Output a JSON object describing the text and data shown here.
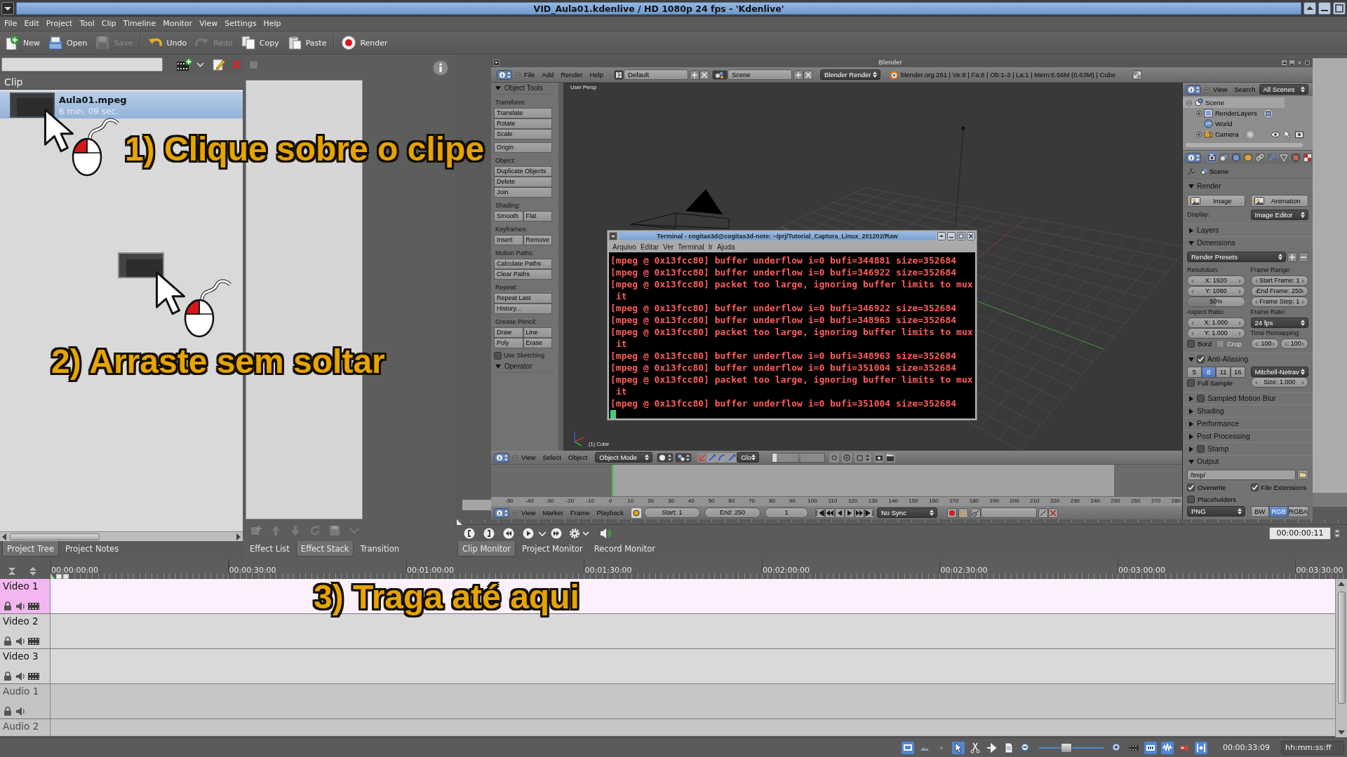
{
  "window": {
    "title": "VID_Aula01.kdenlive / HD 1080p 24 fps - 'Kdenlive'"
  },
  "menu_bar": [
    "File",
    "Edit",
    "Project",
    "Tool",
    "Clip",
    "Timeline",
    "Monitor",
    "View",
    "Settings",
    "Help"
  ],
  "toolbar": {
    "groups": [
      [
        {
          "label": "New",
          "disabled": false
        },
        {
          "label": "Open",
          "disabled": false
        },
        {
          "label": "Save",
          "disabled": true
        }
      ],
      [
        {
          "label": "Undo",
          "disabled": false
        },
        {
          "label": "Redo",
          "disabled": true
        },
        {
          "label": "Copy",
          "disabled": false
        },
        {
          "label": "Paste",
          "disabled": false
        }
      ],
      [
        {
          "label": "Render",
          "disabled": false
        }
      ]
    ]
  },
  "project_tree": {
    "column_header": "Clip",
    "clips": [
      {
        "name": "Aula01.mpeg",
        "duration": "6 min. 09 sec.",
        "selected": true
      }
    ],
    "tabs": [
      {
        "label": "Project Tree",
        "selected": true
      },
      {
        "label": "Project Notes",
        "selected": false
      }
    ]
  },
  "effect_stack": {
    "checkbox": {
      "checked": false
    },
    "tabs": [
      {
        "label": "Effect List",
        "selected": false
      },
      {
        "label": "Effect Stack",
        "selected": true
      },
      {
        "label": "Transition",
        "selected": false
      }
    ]
  },
  "monitor": {
    "blender": {
      "title": "Blender",
      "info_header": {
        "menus": [
          "File",
          "Add",
          "Render",
          "Help"
        ],
        "layout": "Default",
        "scene": "Scene",
        "engine": "Blender Render",
        "stats": "blender.org 261 | Ve:8 | Fa:6 | Ob:1-3 | La:1 | Mem:6.56M (0.63M) | Cube"
      },
      "tool_shelf": {
        "panels": [
          {
            "title": "Object Tools",
            "expanded": true,
            "sections": [
              {
                "label": "Transform:",
                "rows": [
                  [
                    "Translate"
                  ],
                  [
                    "Rotate"
                  ],
                  [
                    "Scale"
                  ]
                ]
              },
              {
                "rows": [
                  [
                    "Origin"
                  ]
                ]
              },
              {
                "label": "Object:",
                "rows": [
                  [
                    "Duplicate Objects"
                  ],
                  [
                    "Delete"
                  ],
                  [
                    "Join"
                  ]
                ]
              },
              {
                "label": "Shading:",
                "rows": [
                  [
                    "Smooth",
                    "Flat"
                  ]
                ]
              },
              {
                "label": "Keyframes:",
                "rows": [
                  [
                    "Insert",
                    "Remove"
                  ]
                ]
              },
              {
                "label": "Motion Paths:",
                "rows": [
                  [
                    "Calculate Paths"
                  ],
                  [
                    "Clear Paths"
                  ]
                ]
              },
              {
                "label": "Repeat:",
                "rows": [
                  [
                    "Repeat Last"
                  ],
                  [
                    "History..."
                  ]
                ]
              },
              {
                "label": "Grease Pencil:",
                "rows": [
                  [
                    "Draw",
                    "Line"
                  ],
                  [
                    "Poly",
                    "Erase"
                  ]
                ]
              }
            ],
            "checkboxes": [
              {
                "label": "Use Sketching",
                "checked": false
              }
            ]
          },
          {
            "title": "Operator",
            "expanded": true
          }
        ]
      },
      "viewport": {
        "view_name": "User Persp",
        "object_name": "(1) Cube"
      },
      "view3d_header": {
        "menus": [
          "View",
          "Select",
          "Object"
        ],
        "mode": "Object Mode",
        "orientation": "Glo"
      },
      "timeline": {
        "ticks": [
          "-50",
          "-40",
          "-30",
          "-20",
          "-10",
          "0",
          "10",
          "20",
          "30",
          "40",
          "50",
          "60",
          "70",
          "80",
          "90",
          "100",
          "110",
          "120",
          "130",
          "140",
          "150",
          "160",
          "170",
          "180",
          "190",
          "200",
          "210",
          "220",
          "230",
          "240",
          "250",
          "260",
          "270",
          "280"
        ],
        "header": {
          "menus": [
            "View",
            "Marker",
            "Frame",
            "Playback"
          ],
          "start": "Start: 1",
          "end": "End: 250",
          "frame": "1",
          "sync": "No Sync"
        }
      },
      "outliner": {
        "menus": [
          "View",
          "Search"
        ],
        "filter": "All Scenes",
        "tree": [
          {
            "label": "Scene",
            "selected": true,
            "expanded": true,
            "children": [
              {
                "label": "RenderLayers",
                "selected": false,
                "expanded": false
              },
              {
                "label": "World",
                "selected": false
              },
              {
                "label": "Camera",
                "selected": false,
                "expanded": false
              }
            ]
          }
        ]
      },
      "properties": {
        "tabs": [
          {
            "selected": true
          },
          {
            "selected": false
          },
          {
            "selected": false
          },
          {
            "selected": false
          },
          {
            "selected": false
          },
          {
            "selected": false
          },
          {
            "selected": false
          },
          {
            "selected": false
          },
          {
            "selected": false
          }
        ],
        "context": "Scene",
        "panels": [
          {
            "title": "Render",
            "expanded": true,
            "blocks": [
              {
                "columns": [
                  [
                    {
                      "kind": "button",
                      "text": "Image"
                    }
                  ],
                  [
                    {
                      "kind": "button",
                      "text": "Animation"
                    }
                  ]
                ]
              },
              {
                "columns": [
                  [
                    {
                      "kind": "label",
                      "text": "Display:"
                    }
                  ],
                  [
                    {
                      "kind": "dropdown",
                      "text": "Image Editor"
                    }
                  ]
                ]
              }
            ]
          },
          {
            "title": "Layers",
            "expanded": false
          },
          {
            "title": "Dimensions",
            "expanded": true,
            "blocks": [
              {
                "columns": [
                  [
                    {
                      "kind": "preset",
                      "text": "Render Presets"
                    }
                  ]
                ]
              },
              {
                "columns": [
                  [
                    {
                      "kind": "label",
                      "text": "Resolution:"
                    },
                    {
                      "kind": "number",
                      "text": "X: 1920"
                    },
                    {
                      "kind": "number",
                      "text": "Y: 1080"
                    },
                    {
                      "kind": "slider",
                      "text": "50%",
                      "level": 0.5
                    },
                    {
                      "kind": "label",
                      "text": "Aspect Ratio:"
                    },
                    {
                      "kind": "number",
                      "text": "X: 1.000"
                    },
                    {
                      "kind": "number",
                      "text": "Y: 1.000"
                    },
                    {
                      "kind": "split",
                      "items": [
                        {
                          "kind": "checkbox",
                          "text": "Bord",
                          "checked": false,
                          "disabled": false
                        },
                        {
                          "kind": "checkbox",
                          "text": "Crop",
                          "checked": false,
                          "disabled": true
                        }
                      ]
                    }
                  ],
                  [
                    {
                      "kind": "label",
                      "text": "Frame Range:"
                    },
                    {
                      "kind": "number",
                      "text": "Start Frame: 1"
                    },
                    {
                      "kind": "number",
                      "text": "End Frame: 250"
                    },
                    {
                      "kind": "number",
                      "text": "Frame Step: 1"
                    },
                    {
                      "kind": "label",
                      "text": "Frame Rate:"
                    },
                    {
                      "kind": "dropdown",
                      "text": "24 fps"
                    },
                    {
                      "kind": "label",
                      "text": "Time Remapping:"
                    },
                    {
                      "kind": "split",
                      "items": [
                        {
                          "kind": "number",
                          "text": ": 100"
                        },
                        {
                          "kind": "number",
                          "text": ": 100"
                        }
                      ]
                    }
                  ]
                ]
              }
            ]
          },
          {
            "title": "Anti-Aliasing",
            "expanded": true,
            "checked": true,
            "blocks": [
              {
                "columns": [
                  [
                    {
                      "kind": "toggles",
                      "options": [
                        {
                          "text": "5",
                          "selected": false
                        },
                        {
                          "text": "8",
                          "selected": true
                        },
                        {
                          "text": "11",
                          "selected": false
                        },
                        {
                          "text": "16",
                          "selected": false
                        }
                      ]
                    },
                    {
                      "kind": "checkbox",
                      "text": "Full Sample",
                      "checked": false
                    }
                  ],
                  [
                    {
                      "kind": "dropdown",
                      "text": "Mitchell-Netrav"
                    },
                    {
                      "kind": "number",
                      "text": "Size: 1.000"
                    }
                  ]
                ]
              }
            ]
          },
          {
            "title": "Sampled Motion Blur",
            "expanded": false,
            "checked": false
          },
          {
            "title": "Shading",
            "expanded": false
          },
          {
            "title": "Performance",
            "expanded": false
          },
          {
            "title": "Post Processing",
            "expanded": false
          },
          {
            "title": "Stamp",
            "expanded": false,
            "checked": false
          },
          {
            "title": "Output",
            "expanded": true,
            "blocks": [
              {
                "columns": [
                  [
                    {
                      "kind": "path",
                      "text": "/tmp/"
                    }
                  ]
                ]
              },
              {
                "columns": [
                  [
                    {
                      "kind": "checkbox",
                      "text": "Overwrite",
                      "checked": true
                    }
                  ],
                  [
                    {
                      "kind": "checkbox",
                      "text": "File Extensions",
                      "checked": true
                    }
                  ]
                ]
              },
              {
                "columns": [
                  [
                    {
                      "kind": "checkbox",
                      "text": "Placeholders",
                      "checked": false
                    }
                  ]
                ]
              },
              {
                "columns": [
                  [
                    {
                      "kind": "dropdown",
                      "text": "PNG"
                    }
                  ],
                  [
                    {
                      "kind": "toggles",
                      "options": [
                        {
                          "text": "BW",
                          "selected": false
                        },
                        {
                          "text": "RGB",
                          "selected": true
                        },
                        {
                          "text": "RGBA",
                          "selected": false
                        }
                      ]
                    }
                  ]
                ]
              }
            ]
          }
        ]
      }
    },
    "terminal": {
      "title": "Terminal - cogitas3d@cogitas3d-note: ~/prj/Tutorial_Captura_Linux_201202/Raw",
      "menu": [
        "Arquivo",
        "Editar",
        "Ver",
        "Terminal",
        "Ir",
        "Ajuda"
      ],
      "lines": [
        {
          "text": "[mpeg @ 0x13fcc80] buffer underflow i=0 bufi=344881 size=352684",
          "wrapped": false
        },
        {
          "text": "[mpeg @ 0x13fcc80] buffer underflow i=0 bufi=346922 size=352684",
          "wrapped": false
        },
        {
          "text": "[mpeg @ 0x13fcc80] packet too large, ignoring buffer limits to mux",
          "wrapped": false
        },
        {
          "text": "it",
          "wrapped": true
        },
        {
          "text": "[mpeg @ 0x13fcc80] buffer underflow i=0 bufi=346922 size=352684",
          "wrapped": false
        },
        {
          "text": "[mpeg @ 0x13fcc80] buffer underflow i=0 bufi=348963 size=352684",
          "wrapped": false
        },
        {
          "text": "[mpeg @ 0x13fcc80] packet too large, ignoring buffer limits to mux",
          "wrapped": false
        },
        {
          "text": "it",
          "wrapped": true
        },
        {
          "text": "[mpeg @ 0x13fcc80] buffer underflow i=0 bufi=348963 size=352684",
          "wrapped": false
        },
        {
          "text": "[mpeg @ 0x13fcc80] buffer underflow i=0 bufi=351004 size=352684",
          "wrapped": false
        },
        {
          "text": "[mpeg @ 0x13fcc80] packet too large, ignoring buffer limits to mux",
          "wrapped": false
        },
        {
          "text": "it",
          "wrapped": true
        },
        {
          "text": "[mpeg @ 0x13fcc80] buffer underflow i=0 bufi=351004 size=352684",
          "wrapped": false
        }
      ]
    },
    "timecode": "00:00:00:11",
    "tabs": [
      {
        "label": "Clip Monitor",
        "selected": true
      },
      {
        "label": "Project Monitor",
        "selected": false
      },
      {
        "label": "Record Monitor",
        "selected": false
      }
    ]
  },
  "timeline": {
    "ruler": [
      "00:00:00:00",
      "00:00:30:00",
      "00:01:00:00",
      "00:01:30:00",
      "00:02:00:00",
      "00:02:30:00",
      "00:03:00:00",
      "00:03:30:00"
    ],
    "tracks": [
      {
        "name": "Video 1",
        "kind": "video",
        "selected": true
      },
      {
        "name": "Video 2",
        "kind": "video",
        "selected": false
      },
      {
        "name": "Video 3",
        "kind": "video",
        "selected": false
      },
      {
        "name": "Audio 1",
        "kind": "audio",
        "selected": false
      },
      {
        "name": "Audio 2",
        "kind": "audio",
        "selected": false
      }
    ]
  },
  "status_bar": {
    "left_tools": [
      {
        "on": true
      },
      {
        "on": false
      },
      {
        "on": false
      },
      {
        "on": true
      },
      {
        "on": false
      },
      {
        "on": false
      },
      {
        "on": false
      },
      {
        "on": false
      }
    ],
    "zoom": {
      "level": 0.43
    },
    "right_tools": [
      {
        "on": false
      },
      {
        "on": false
      },
      {
        "on": true
      },
      {
        "on": true
      },
      {
        "on": false
      },
      {
        "on": true
      }
    ],
    "timecode": "00:00:33:09",
    "time_format": "hh:mm:ss:ff"
  },
  "annotations": [
    {
      "text": "1) Clique sobre o clipe"
    },
    {
      "text": "2) Arraste sem soltar"
    },
    {
      "text": "3) Traga até aqui"
    }
  ]
}
